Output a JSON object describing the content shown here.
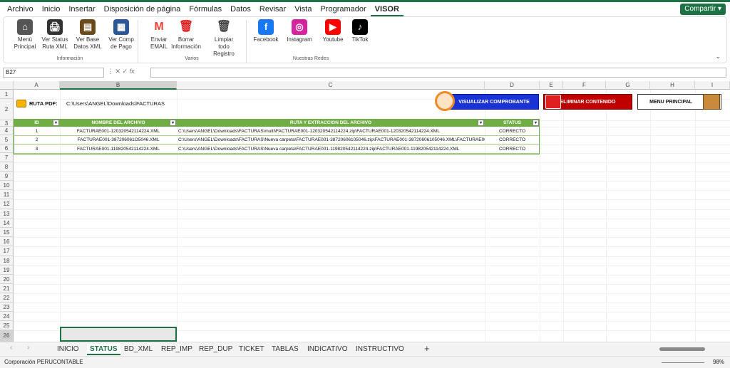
{
  "menu": {
    "items": [
      "Archivo",
      "Inicio",
      "Insertar",
      "Disposición de página",
      "Fórmulas",
      "Datos",
      "Revisar",
      "Vista",
      "Programador",
      "VISOR"
    ],
    "share": "Compartir"
  },
  "ribbon": {
    "buttons": [
      {
        "label": "Menú\nPrincipal",
        "icon": "home-icon"
      },
      {
        "label": "Ver Status\nRuta XML",
        "icon": "printer-icon"
      },
      {
        "label": "Ver Base\nDatos XML",
        "icon": "database-icon"
      },
      {
        "label": "Ver Comp\nde Pago",
        "icon": "document-icon"
      },
      {
        "label": "Enviar\nEMAIL",
        "icon": "gmail-icon"
      },
      {
        "label": "Borrar\nInformación",
        "icon": "trash-icon"
      },
      {
        "label": "Limpiar todo\nRegistro",
        "icon": "trash-can-icon"
      },
      {
        "label": "Facebook",
        "icon": "facebook-icon"
      },
      {
        "label": "Instagram",
        "icon": "instagram-icon"
      },
      {
        "label": "Youtube",
        "icon": "youtube-icon"
      },
      {
        "label": "TikTok",
        "icon": "tiktok-icon"
      }
    ],
    "groups": [
      "Información",
      "Varios",
      "Nuestras Redes"
    ]
  },
  "formula": {
    "namebox": "B27",
    "fx": "fx",
    "value": ""
  },
  "columns": [
    "A",
    "B",
    "C",
    "D",
    "E",
    "F",
    "G",
    "H",
    "I"
  ],
  "rows": [
    "1",
    "2",
    "3",
    "4",
    "5",
    "6",
    "7",
    "8",
    "9",
    "10",
    "11",
    "12",
    "13",
    "14",
    "15",
    "16",
    "17",
    "18",
    "19",
    "20",
    "21",
    "22",
    "23",
    "24",
    "25",
    "26"
  ],
  "sheet": {
    "ruta_label": "RUTA PDF:",
    "ruta_value": "C:\\Users\\ANGEL\\Downloads\\FACTURAS",
    "btn_visualizar": "VISUALIZAR COMPROBANTE",
    "btn_eliminar": "ELIMINAR CONTENIDO",
    "btn_menu": "MENU PRINCIPAL",
    "headers": [
      "ID",
      "NOMBRE DEL ARCHIVO",
      "RUTA Y EXTRACCION DEL ARCHIVO",
      "STATUS"
    ],
    "data": [
      [
        "1",
        "FACTURAE001-120320542114224.XML",
        "C:\\Users\\ANGEL\\Downloads\\FACTURAS\\multi\\FACTURAE001-120320542114224.zip\\FACTURAE001-120320542114224.XML",
        "CORRECTO"
      ],
      [
        "2",
        "FACTURAE001-387206061O5046.XML",
        "C:\\Users\\ANGEL\\Downloads\\FACTURAS\\Nueva carpeta\\FACTURAE001-38720606105046.zip\\FACTURAE001-38720606105046.XML\\FACTURAE001-3",
        "CORRECTO"
      ],
      [
        "3",
        "FACTURAE001-119820542114224.XML",
        "C:\\Users\\ANGEL\\Downloads\\FACTURAS\\Nueva carpeta\\FACTURAE001-119820542114224.zip\\FACTURAE001-119820542114224.XML",
        "CORRECTO"
      ]
    ]
  },
  "tabs": [
    "INICIO",
    "STATUS",
    "BD_XML",
    "REP_IMP",
    "REP_DUP",
    "TICKET",
    "TABLAS",
    "INDICATIVO",
    "INSTRUCTIVO"
  ],
  "active_tab": "STATUS",
  "statusbar": {
    "text": "Corporación PERUCONTABLE",
    "zoom": "98%"
  },
  "colors": {
    "accent": "#1e7145",
    "table_header": "#70ad47",
    "visualizar": "#1a33d6",
    "eliminar": "#c00000"
  }
}
